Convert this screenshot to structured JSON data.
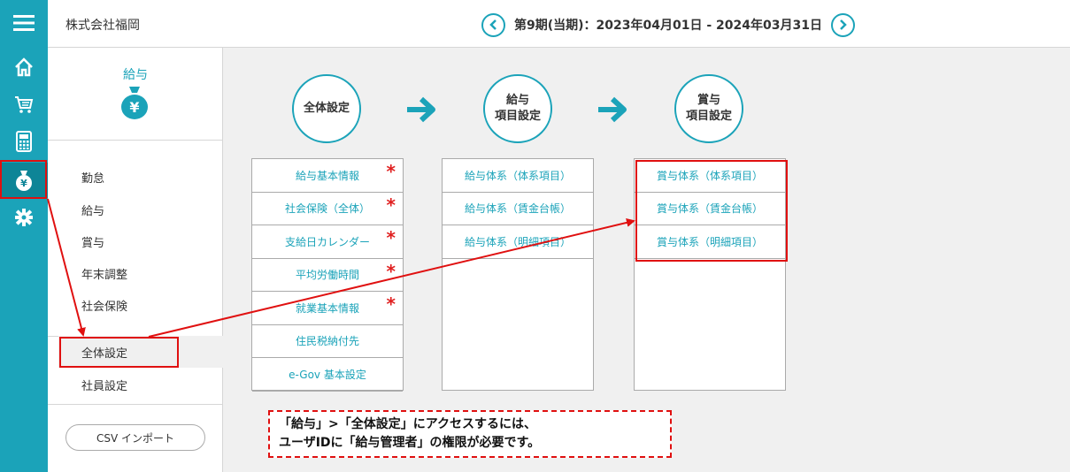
{
  "header": {
    "company": "株式会社福岡",
    "period": "第9期(当期)：2023年04月01日 - 2024年03月31日"
  },
  "sidebar": {
    "section_title": "給与",
    "menu": [
      "勤怠",
      "給与",
      "賞与",
      "年末調整",
      "社会保険"
    ],
    "sub_menu": [
      "全体設定",
      "社員設定"
    ],
    "csv_button": "CSV インポート"
  },
  "steps": [
    {
      "label_l1": "全体設定",
      "label_l2": ""
    },
    {
      "label_l1": "給与",
      "label_l2": "項目設定"
    },
    {
      "label_l1": "賞与",
      "label_l2": "項目設定"
    }
  ],
  "columns": {
    "general": [
      {
        "label": "給与基本情報",
        "required": true
      },
      {
        "label": "社会保険（全体）",
        "required": true
      },
      {
        "label": "支給日カレンダー",
        "required": true
      },
      {
        "label": "平均労働時間",
        "required": true
      },
      {
        "label": "就業基本情報",
        "required": true
      },
      {
        "label": "住民税納付先",
        "required": false
      },
      {
        "label": "e-Gov 基本設定",
        "required": false
      }
    ],
    "salary": [
      "給与体系（体系項目）",
      "給与体系（賃金台帳）",
      "給与体系（明細項目）"
    ],
    "bonus": [
      "賞与体系（体系項目）",
      "賞与体系（賃金台帳）",
      "賞与体系（明細項目）"
    ]
  },
  "required_mark": "*",
  "note": {
    "line1": "「給与」>「全体設定」にアクセスするには、",
    "line2": "ユーザIDに「給与管理者」の権限が必要です。"
  },
  "colors": {
    "accent": "#1ba3b9",
    "highlight": "#e01010"
  }
}
